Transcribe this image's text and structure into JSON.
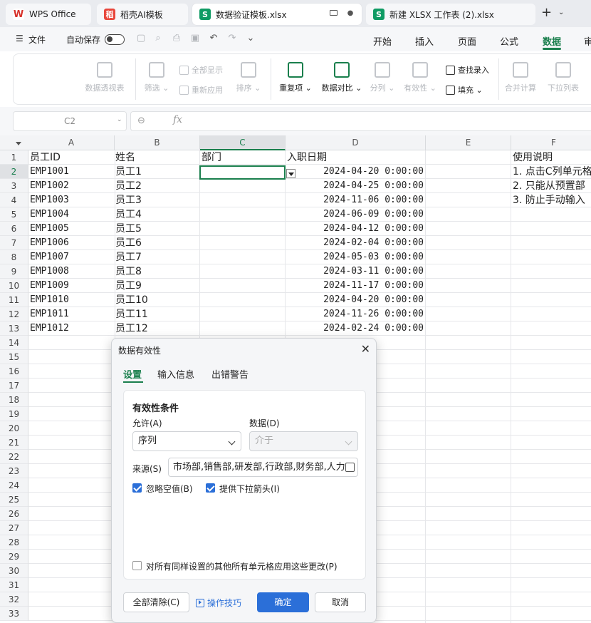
{
  "tabs": [
    {
      "label": "WPS Office",
      "icon": "wps-logo-icon"
    },
    {
      "label": "稻壳AI模板",
      "icon": "docer-icon"
    },
    {
      "label": "数据验证模板.xlsx",
      "icon": "sheet-icon"
    },
    {
      "label": "新建 XLSX 工作表 (2).xlsx",
      "icon": "sheet-icon"
    }
  ],
  "menubar": {
    "menu_label": "文件",
    "autosave_label": "自动保存",
    "autosave_on": false
  },
  "ribbon_tabs": [
    "开始",
    "插入",
    "页面",
    "公式",
    "数据",
    "审"
  ],
  "active_ribbon_tab": "数据",
  "ribbon": {
    "pivot": "数据透视表",
    "filter": "筛选",
    "show_all": "全部显示",
    "reapply": "重新应用",
    "sort": "排序",
    "duplicates": "重复项",
    "compare": "数据对比",
    "split": "分列",
    "validity": "有效性",
    "lookup_entry": "查找录入",
    "fill": "填充",
    "consolidate": "合并计算",
    "dropdown_list": "下拉列表"
  },
  "formula_bar": {
    "cell_ref": "C2",
    "fx": "fx",
    "value": ""
  },
  "columns": [
    "A",
    "B",
    "C",
    "D",
    "E",
    "F"
  ],
  "selected_column": "C",
  "selected_row": 2,
  "rows": [
    "1",
    "2",
    "3",
    "4",
    "5",
    "6",
    "7",
    "8",
    "9",
    "10",
    "11",
    "12",
    "13",
    "14",
    "15",
    "16",
    "17",
    "18",
    "19",
    "20",
    "21",
    "22",
    "23",
    "24",
    "25",
    "26",
    "27",
    "28",
    "29",
    "30",
    "31",
    "32",
    "33"
  ],
  "header_row": {
    "a": "员工ID",
    "b": "姓名",
    "c": "部门",
    "d": "入职日期",
    "f": "使用说明"
  },
  "employees": [
    {
      "id": "EMP1001",
      "name": "员工1",
      "date": "2024-04-20 0:00:00"
    },
    {
      "id": "EMP1002",
      "name": "员工2",
      "date": "2024-04-25 0:00:00"
    },
    {
      "id": "EMP1003",
      "name": "员工3",
      "date": "2024-11-06 0:00:00"
    },
    {
      "id": "EMP1004",
      "name": "员工4",
      "date": "2024-06-09 0:00:00"
    },
    {
      "id": "EMP1005",
      "name": "员工5",
      "date": "2024-04-12 0:00:00"
    },
    {
      "id": "EMP1006",
      "name": "员工6",
      "date": "2024-02-04 0:00:00"
    },
    {
      "id": "EMP1007",
      "name": "员工7",
      "date": "2024-05-03 0:00:00"
    },
    {
      "id": "EMP1008",
      "name": "员工8",
      "date": "2024-03-11 0:00:00"
    },
    {
      "id": "EMP1009",
      "name": "员工9",
      "date": "2024-11-17 0:00:00"
    },
    {
      "id": "EMP1010",
      "name": "员工10",
      "date": "2024-04-20 0:00:00"
    },
    {
      "id": "EMP1011",
      "name": "员工11",
      "date": "2024-11-26 0:00:00"
    },
    {
      "id": "EMP1012",
      "name": "员工12",
      "date": "2024-02-24 0:00:00"
    }
  ],
  "instructions": [
    "1. 点击C列单元格",
    "2. 只能从预置部",
    "3. 防止手动输入"
  ],
  "dialog": {
    "title": "数据有效性",
    "tabs": [
      "设置",
      "输入信息",
      "出错警告"
    ],
    "active_tab": "设置",
    "condition_title": "有效性条件",
    "allow_label": "允许(A)",
    "allow_value": "序列",
    "data_label": "数据(D)",
    "data_value": "介于",
    "source_label": "来源(S)",
    "source_value": "市场部,销售部,研发部,行政部,财务部,人力",
    "ignore_blank_label": "忽略空值(B)",
    "ignore_blank_checked": true,
    "dropdown_arrow_label": "提供下拉箭头(I)",
    "dropdown_arrow_checked": true,
    "apply_all_label": "对所有同样设置的其他所有单元格应用这些更改(P)",
    "apply_all_checked": false,
    "clear_all": "全部清除(C)",
    "tips": "操作技巧",
    "ok": "确定",
    "cancel": "取消"
  }
}
